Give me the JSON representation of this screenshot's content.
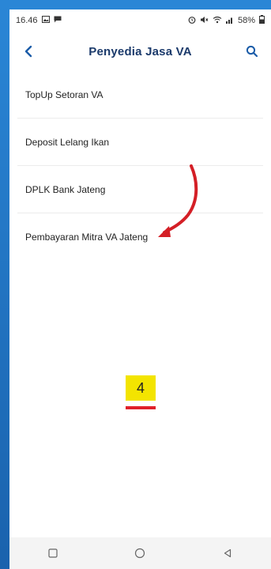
{
  "status_bar": {
    "time": "16.46",
    "battery": "58%"
  },
  "header": {
    "title": "Penyedia Jasa VA"
  },
  "list": {
    "items": [
      {
        "label": "TopUp Setoran VA"
      },
      {
        "label": "Deposit Lelang Ikan"
      },
      {
        "label": "DPLK Bank Jateng"
      },
      {
        "label": "Pembayaran Mitra VA Jateng"
      }
    ]
  },
  "annotation": {
    "step_number": "4"
  },
  "colors": {
    "header_title": "#1b3a6b",
    "accent_blue": "#1b5ca8",
    "arrow_red": "#d41f26",
    "badge_yellow": "#f3e400"
  }
}
